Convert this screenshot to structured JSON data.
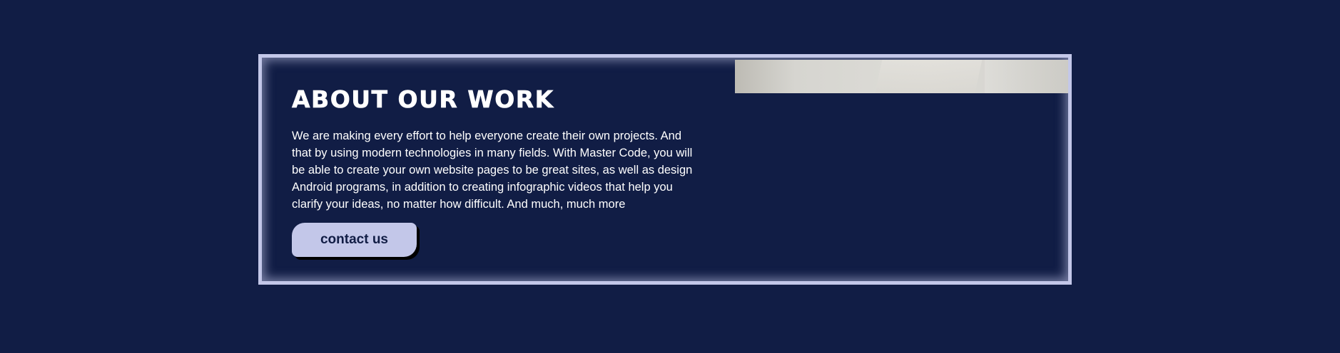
{
  "about": {
    "title": "ABOUT OUR WORK",
    "description": "We are making every effort to help everyone create their own projects. And that by using modern technologies in many fields. With Master Code, you will be able to create your own website pages to be great sites, as well as design Android programs, in addition to creating infographic videos that help you clarify your ideas, no matter how difficult. And much, much more",
    "button_label": "contact us"
  },
  "colors": {
    "background": "#111d45",
    "accent": "#c3c7e9",
    "text": "#ffffff"
  }
}
